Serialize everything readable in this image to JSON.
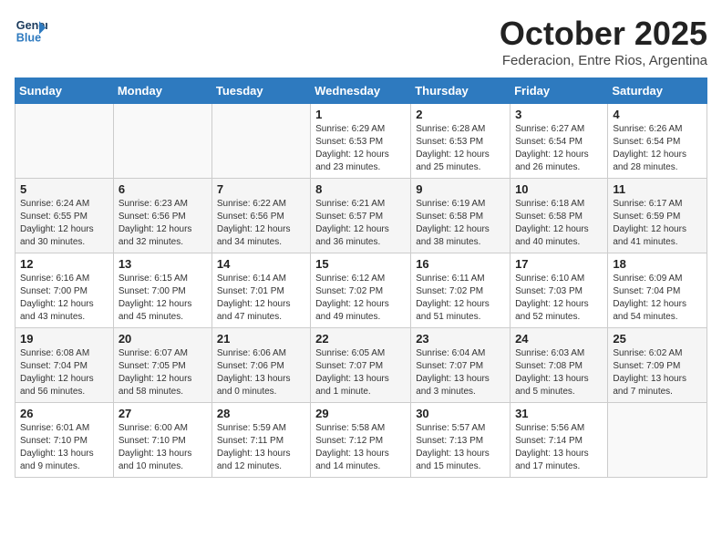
{
  "header": {
    "logo_line1": "General",
    "logo_line2": "Blue",
    "month_year": "October 2025",
    "location": "Federacion, Entre Rios, Argentina"
  },
  "weekdays": [
    "Sunday",
    "Monday",
    "Tuesday",
    "Wednesday",
    "Thursday",
    "Friday",
    "Saturday"
  ],
  "weeks": [
    [
      {
        "day": "",
        "info": ""
      },
      {
        "day": "",
        "info": ""
      },
      {
        "day": "",
        "info": ""
      },
      {
        "day": "1",
        "info": "Sunrise: 6:29 AM\nSunset: 6:53 PM\nDaylight: 12 hours\nand 23 minutes."
      },
      {
        "day": "2",
        "info": "Sunrise: 6:28 AM\nSunset: 6:53 PM\nDaylight: 12 hours\nand 25 minutes."
      },
      {
        "day": "3",
        "info": "Sunrise: 6:27 AM\nSunset: 6:54 PM\nDaylight: 12 hours\nand 26 minutes."
      },
      {
        "day": "4",
        "info": "Sunrise: 6:26 AM\nSunset: 6:54 PM\nDaylight: 12 hours\nand 28 minutes."
      }
    ],
    [
      {
        "day": "5",
        "info": "Sunrise: 6:24 AM\nSunset: 6:55 PM\nDaylight: 12 hours\nand 30 minutes."
      },
      {
        "day": "6",
        "info": "Sunrise: 6:23 AM\nSunset: 6:56 PM\nDaylight: 12 hours\nand 32 minutes."
      },
      {
        "day": "7",
        "info": "Sunrise: 6:22 AM\nSunset: 6:56 PM\nDaylight: 12 hours\nand 34 minutes."
      },
      {
        "day": "8",
        "info": "Sunrise: 6:21 AM\nSunset: 6:57 PM\nDaylight: 12 hours\nand 36 minutes."
      },
      {
        "day": "9",
        "info": "Sunrise: 6:19 AM\nSunset: 6:58 PM\nDaylight: 12 hours\nand 38 minutes."
      },
      {
        "day": "10",
        "info": "Sunrise: 6:18 AM\nSunset: 6:58 PM\nDaylight: 12 hours\nand 40 minutes."
      },
      {
        "day": "11",
        "info": "Sunrise: 6:17 AM\nSunset: 6:59 PM\nDaylight: 12 hours\nand 41 minutes."
      }
    ],
    [
      {
        "day": "12",
        "info": "Sunrise: 6:16 AM\nSunset: 7:00 PM\nDaylight: 12 hours\nand 43 minutes."
      },
      {
        "day": "13",
        "info": "Sunrise: 6:15 AM\nSunset: 7:00 PM\nDaylight: 12 hours\nand 45 minutes."
      },
      {
        "day": "14",
        "info": "Sunrise: 6:14 AM\nSunset: 7:01 PM\nDaylight: 12 hours\nand 47 minutes."
      },
      {
        "day": "15",
        "info": "Sunrise: 6:12 AM\nSunset: 7:02 PM\nDaylight: 12 hours\nand 49 minutes."
      },
      {
        "day": "16",
        "info": "Sunrise: 6:11 AM\nSunset: 7:02 PM\nDaylight: 12 hours\nand 51 minutes."
      },
      {
        "day": "17",
        "info": "Sunrise: 6:10 AM\nSunset: 7:03 PM\nDaylight: 12 hours\nand 52 minutes."
      },
      {
        "day": "18",
        "info": "Sunrise: 6:09 AM\nSunset: 7:04 PM\nDaylight: 12 hours\nand 54 minutes."
      }
    ],
    [
      {
        "day": "19",
        "info": "Sunrise: 6:08 AM\nSunset: 7:04 PM\nDaylight: 12 hours\nand 56 minutes."
      },
      {
        "day": "20",
        "info": "Sunrise: 6:07 AM\nSunset: 7:05 PM\nDaylight: 12 hours\nand 58 minutes."
      },
      {
        "day": "21",
        "info": "Sunrise: 6:06 AM\nSunset: 7:06 PM\nDaylight: 13 hours\nand 0 minutes."
      },
      {
        "day": "22",
        "info": "Sunrise: 6:05 AM\nSunset: 7:07 PM\nDaylight: 13 hours\nand 1 minute."
      },
      {
        "day": "23",
        "info": "Sunrise: 6:04 AM\nSunset: 7:07 PM\nDaylight: 13 hours\nand 3 minutes."
      },
      {
        "day": "24",
        "info": "Sunrise: 6:03 AM\nSunset: 7:08 PM\nDaylight: 13 hours\nand 5 minutes."
      },
      {
        "day": "25",
        "info": "Sunrise: 6:02 AM\nSunset: 7:09 PM\nDaylight: 13 hours\nand 7 minutes."
      }
    ],
    [
      {
        "day": "26",
        "info": "Sunrise: 6:01 AM\nSunset: 7:10 PM\nDaylight: 13 hours\nand 9 minutes."
      },
      {
        "day": "27",
        "info": "Sunrise: 6:00 AM\nSunset: 7:10 PM\nDaylight: 13 hours\nand 10 minutes."
      },
      {
        "day": "28",
        "info": "Sunrise: 5:59 AM\nSunset: 7:11 PM\nDaylight: 13 hours\nand 12 minutes."
      },
      {
        "day": "29",
        "info": "Sunrise: 5:58 AM\nSunset: 7:12 PM\nDaylight: 13 hours\nand 14 minutes."
      },
      {
        "day": "30",
        "info": "Sunrise: 5:57 AM\nSunset: 7:13 PM\nDaylight: 13 hours\nand 15 minutes."
      },
      {
        "day": "31",
        "info": "Sunrise: 5:56 AM\nSunset: 7:14 PM\nDaylight: 13 hours\nand 17 minutes."
      },
      {
        "day": "",
        "info": ""
      }
    ]
  ]
}
